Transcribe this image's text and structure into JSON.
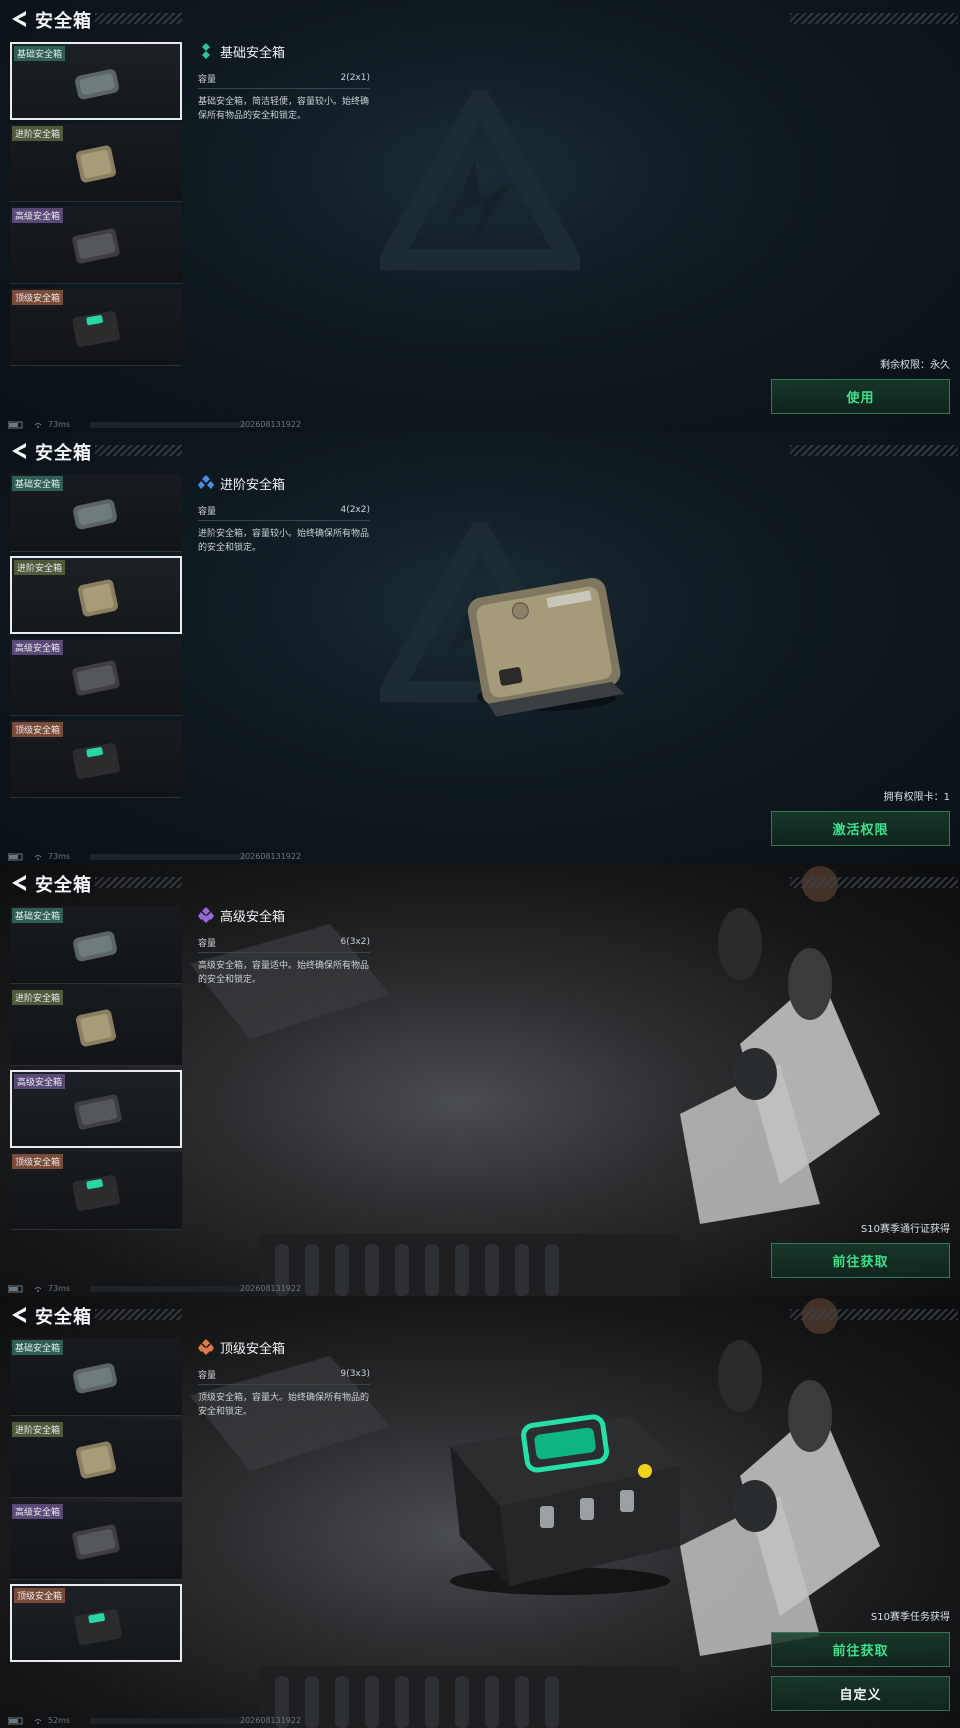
{
  "header": {
    "title": "安全箱"
  },
  "cases": [
    {
      "tag": "基础安全箱"
    },
    {
      "tag": "进阶安全箱"
    },
    {
      "tag": "高级安全箱"
    },
    {
      "tag": "顶级安全箱"
    }
  ],
  "capacity_label": "容量",
  "panels": [
    {
      "selected_index": 0,
      "name": "基础安全箱",
      "capacity": "2(2x1)",
      "desc": "基础安全箱，简洁轻便，容量较小。始终确保所有物品的安全和锁定。",
      "status": "剩余权限：永久",
      "button": "使用",
      "ping": "73ms",
      "build": "202608131922"
    },
    {
      "selected_index": 1,
      "name": "进阶安全箱",
      "capacity": "4(2x2)",
      "desc": "进阶安全箱，容量较小。始终确保所有物品的安全和锁定。",
      "status": "拥有权限卡：1",
      "button": "激活权限",
      "ping": "73ms",
      "build": "202608131922"
    },
    {
      "selected_index": 2,
      "name": "高级安全箱",
      "capacity": "6(3x2)",
      "desc": "高级安全箱，容量适中。始终确保所有物品的安全和锁定。",
      "status": "S10赛季通行证获得",
      "button": "前往获取",
      "ping": "73ms",
      "build": "202608131922"
    },
    {
      "selected_index": 3,
      "name": "顶级安全箱",
      "capacity": "9(3x3)",
      "desc": "顶级安全箱，容量大。始终确保所有物品的安全和锁定。",
      "status": "S10赛季任务获得",
      "button": "前往获取",
      "button2": "自定义",
      "ping": "52ms",
      "build": "202608131922"
    }
  ],
  "colors": {
    "accent_green": "#3fe08a",
    "tag_basic": "#2f5e55",
    "tag_advanced": "#4f5a3a",
    "tag_high": "#5a4877",
    "tag_top": "#7a4a36"
  }
}
